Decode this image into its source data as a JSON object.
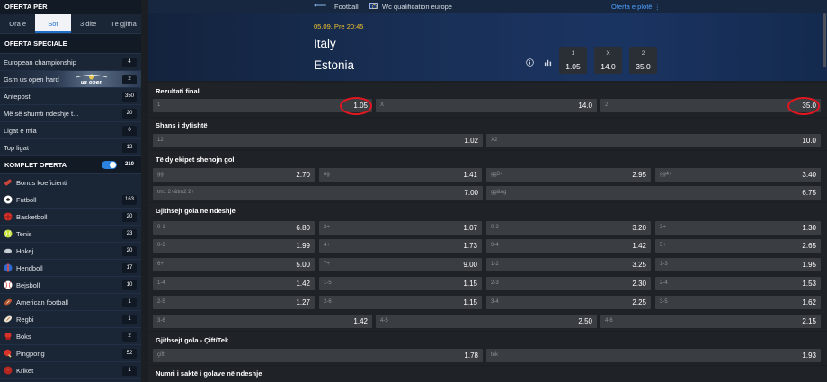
{
  "sidebar": {
    "header": "OFERTA PËR",
    "tabs": [
      "Ora e",
      "Sot",
      "3 ditë",
      "Të gjitha"
    ],
    "active_tab": "Sot",
    "special_title": "OFERTA SPECIALE",
    "special": [
      {
        "label": "European championship",
        "count": "4"
      },
      {
        "label": "Gsm us open hard",
        "count": "2",
        "banner_text": "us open"
      },
      {
        "label": "Antepost",
        "count": "350"
      },
      {
        "label": "Më së shumti ndeshje t...",
        "count": "20"
      },
      {
        "label": "Ligat e mia",
        "count": "0"
      },
      {
        "label": "Top ligat",
        "count": "12"
      }
    ],
    "komplet": {
      "label": "KOMPLET OFERTA",
      "count": "210"
    },
    "sports": [
      {
        "label": "Bonus koeficienti",
        "count": "",
        "icon": "bonus-icon"
      },
      {
        "label": "Futboll",
        "count": "163",
        "icon": "football-icon"
      },
      {
        "label": "Basketboll",
        "count": "20",
        "icon": "basketball-icon"
      },
      {
        "label": "Tenis",
        "count": "23",
        "icon": "tennis-icon"
      },
      {
        "label": "Hokej",
        "count": "20",
        "icon": "hockey-icon"
      },
      {
        "label": "Hendboll",
        "count": "17",
        "icon": "handball-icon"
      },
      {
        "label": "Bejsboll",
        "count": "10",
        "icon": "baseball-icon"
      },
      {
        "label": "American football",
        "count": "1",
        "icon": "american-football-icon"
      },
      {
        "label": "Regbi",
        "count": "1",
        "icon": "rugby-icon"
      },
      {
        "label": "Boks",
        "count": "2",
        "icon": "boxing-icon"
      },
      {
        "label": "Pingpong",
        "count": "52",
        "icon": "pingpong-icon"
      },
      {
        "label": "Kriket",
        "count": "1",
        "icon": "cricket-icon"
      }
    ]
  },
  "breadcrumb": {
    "sport": "Football",
    "league": "Wc qualification europe",
    "full_offer": "Oferta e plotë ⋮"
  },
  "match": {
    "datetime": "05.09. Pre 20:45",
    "home": "Italy",
    "away": "Estonia",
    "odds": [
      {
        "key": "1",
        "value": "1.05"
      },
      {
        "key": "X",
        "value": "14.0"
      },
      {
        "key": "2",
        "value": "35.0"
      }
    ]
  },
  "markets": [
    {
      "title": "Rezultati final",
      "rows": [
        [
          {
            "label": "1",
            "odd": "1.05"
          },
          {
            "label": "X",
            "odd": "14.0"
          },
          {
            "label": "2",
            "odd": "35.0"
          }
        ]
      ]
    },
    {
      "title": "Shans i dyfishtë",
      "rows": [
        [
          {
            "label": "12",
            "odd": "1.02"
          },
          {
            "label": "X2",
            "odd": "10.0"
          }
        ]
      ]
    },
    {
      "title": "Të dy ekipet shenojn gol",
      "rows": [
        [
          {
            "label": "gg",
            "odd": "2.70"
          },
          {
            "label": "ng",
            "odd": "1.41"
          },
          {
            "label": "gg3+",
            "odd": "2.95"
          },
          {
            "label": "gg4+",
            "odd": "3.40"
          }
        ],
        [
          {
            "label": "tm1 2+&tm2 2+",
            "odd": "7.00"
          },
          {
            "label": "gg&ng",
            "odd": "6.75"
          }
        ]
      ]
    },
    {
      "title": "Gjithsejt gola në ndeshje",
      "rows": [
        [
          {
            "label": "0-1",
            "odd": "6.80"
          },
          {
            "label": "2+",
            "odd": "1.07"
          },
          {
            "label": "0-2",
            "odd": "3.20"
          },
          {
            "label": "3+",
            "odd": "1.30"
          }
        ],
        [
          {
            "label": "0-3",
            "odd": "1.99"
          },
          {
            "label": "4+",
            "odd": "1.73"
          },
          {
            "label": "0-4",
            "odd": "1.42"
          },
          {
            "label": "5+",
            "odd": "2.65"
          }
        ],
        [
          {
            "label": "6+",
            "odd": "5.00"
          },
          {
            "label": "7+",
            "odd": "9.00"
          },
          {
            "label": "1-2",
            "odd": "3.25"
          },
          {
            "label": "1-3",
            "odd": "1.95"
          }
        ],
        [
          {
            "label": "1-4",
            "odd": "1.42"
          },
          {
            "label": "1-5",
            "odd": "1.15"
          },
          {
            "label": "2-3",
            "odd": "2.30"
          },
          {
            "label": "2-4",
            "odd": "1.53"
          }
        ],
        [
          {
            "label": "2-5",
            "odd": "1.27"
          },
          {
            "label": "2-6",
            "odd": "1.15"
          },
          {
            "label": "3-4",
            "odd": "2.25"
          },
          {
            "label": "3-5",
            "odd": "1.62"
          }
        ],
        [
          {
            "label": "3-6",
            "odd": "1.42"
          },
          {
            "label": "4-5",
            "odd": "2.50"
          },
          {
            "label": "4-6",
            "odd": "2.15"
          }
        ]
      ]
    },
    {
      "title": "Gjithsejt gola - Çift/Tek",
      "rows": [
        [
          {
            "label": "çift",
            "odd": "1.78"
          },
          {
            "label": "tek",
            "odd": "1.93"
          }
        ]
      ]
    },
    {
      "title": "Numri i saktë i golave në ndeshje",
      "rows": []
    }
  ],
  "colors": {
    "accent": "#1f6fc8",
    "highlight": "#e1161f",
    "date": "#f0c12d",
    "link": "#4fa0ff"
  }
}
